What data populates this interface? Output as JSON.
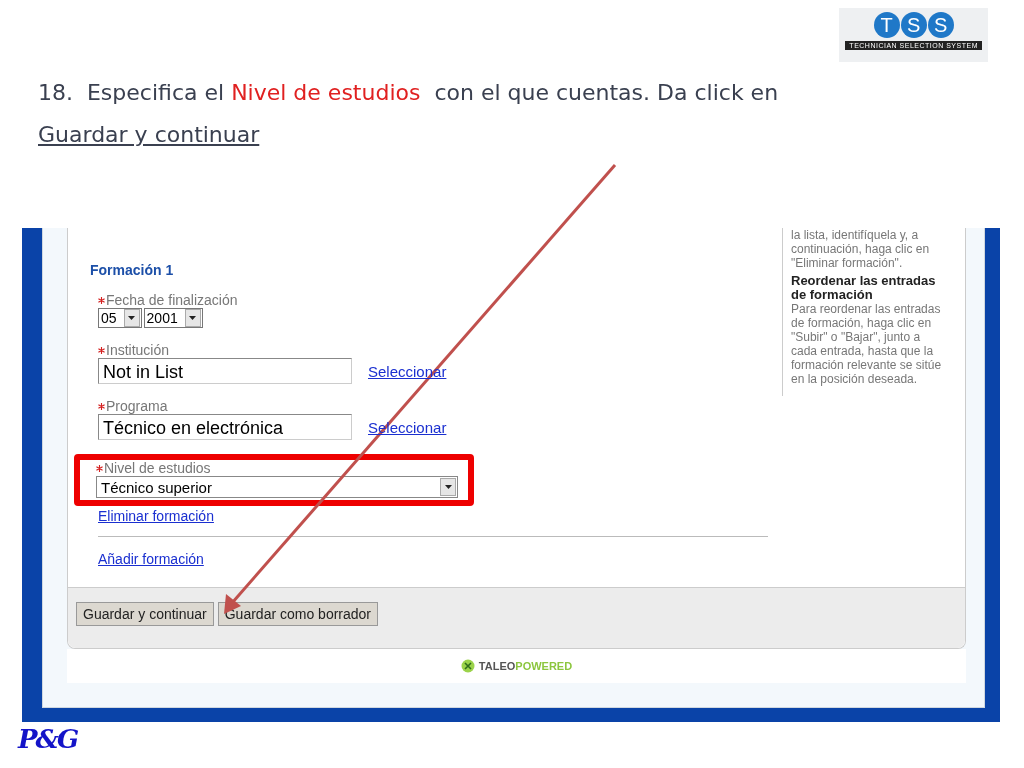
{
  "logo": {
    "letters": [
      "T",
      "S",
      "S"
    ],
    "tagline": "TECHNICIAN SELECTION SYSTEM"
  },
  "instruction": {
    "number": "18.",
    "before": "Especifica el",
    "highlight": "Nivel de estudios",
    "middle": "con el que cuentas. Da click en",
    "link": "Guardar y continuar"
  },
  "form": {
    "section_title": "Formación 1",
    "fields": [
      {
        "kind": "date",
        "label": "Fecha de finalización",
        "required": true,
        "month": "05",
        "year": "2001",
        "highlighted": false
      },
      {
        "kind": "lookup",
        "label": "Institución",
        "required": true,
        "value": "Not in List",
        "action": "Seleccionar",
        "highlighted": false
      },
      {
        "kind": "lookup",
        "label": "Programa",
        "required": true,
        "value": "Técnico en electrónica",
        "action": "Seleccionar",
        "highlighted": false
      },
      {
        "kind": "select",
        "label": "Nivel de estudios",
        "required": true,
        "value": "Técnico superior",
        "highlighted": true
      }
    ],
    "remove_link": "Eliminar formación",
    "add_link": "Añadir formación"
  },
  "help": [
    {
      "kind": "text",
      "text": "la lista, identifíquela y, a continuación, haga clic en \"Eliminar formación\"."
    },
    {
      "kind": "heading",
      "text": "Reordenar las entradas de formación"
    },
    {
      "kind": "text",
      "text": "Para reordenar las entradas de formación, haga clic en \"Subir\" o \"Bajar\", junto a cada entrada, hasta que la formación relevante se sitúe en la posición deseada."
    }
  ],
  "buttons": [
    {
      "label": "Guardar y continuar"
    },
    {
      "label": "Guardar como borrador"
    }
  ],
  "powered_by": {
    "brand": "TALEO",
    "suffix": "POWERED"
  },
  "footer_logo": "P&G"
}
